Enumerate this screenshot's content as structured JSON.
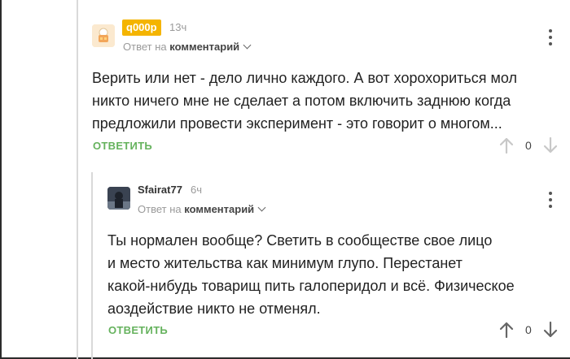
{
  "comments": [
    {
      "username": "q000p",
      "time": "13ч",
      "reply_to_prefix": "Ответ на",
      "reply_to_target": "комментарий",
      "text_lines": [
        "Верить или нет - дело лично каждого. А вот хорохориться мол",
        "никто ничего мне не сделает а потом включить заднюю когда",
        "предложили провести эксперимент - это говорит о многом..."
      ],
      "reply_label": "ОТВЕТИТЬ",
      "rating": "0"
    },
    {
      "username": "Sfairat77",
      "time": "6ч",
      "reply_to_prefix": "Ответ на",
      "reply_to_target": "комментарий",
      "text_lines": [
        "Ты нормален вообще? Светить в сообществе свое лицо",
        "и место жительства как минимум глупо. Перестанет",
        "какой-нибудь товарищ пить галоперидол и всё. Физическое",
        "аоздействие никто не отменял."
      ],
      "reply_label": "ОТВЕТИТЬ",
      "rating": "0"
    }
  ],
  "colors": {
    "badge": "#f4b400",
    "reply": "#65b25d",
    "muted": "#9a9a9a"
  }
}
